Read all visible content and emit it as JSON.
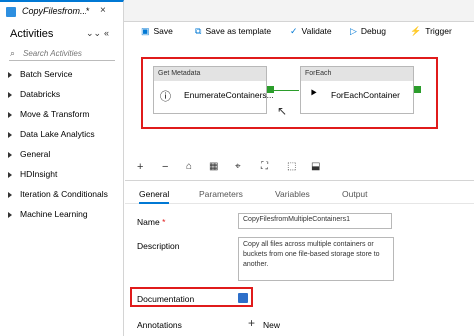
{
  "doc_tab": {
    "title": "CopyFilesfrom...",
    "modified": "*",
    "close": "×"
  },
  "sidebar": {
    "title": "Activities",
    "collapse_icon": "double-chevron-down",
    "minimize_icon": "double-chevron-left",
    "search_placeholder": "Search Activities",
    "categories": [
      "Batch Service",
      "Databricks",
      "Move & Transform",
      "Data Lake Analytics",
      "General",
      "HDInsight",
      "Iteration & Conditionals",
      "Machine Learning"
    ]
  },
  "toolbar": {
    "save": "Save",
    "save_template": "Save as template",
    "validate": "Validate",
    "debug": "Debug",
    "trigger": "Trigger"
  },
  "canvas": {
    "activities": [
      {
        "type": "Get Metadata",
        "name": "EnumerateContainers..."
      },
      {
        "type": "ForEach",
        "name": "ForEachContainer"
      }
    ],
    "highlight_color": "#e01b1b",
    "connector_color": "#2b9d2b"
  },
  "canvas_tools": [
    "plus",
    "minus",
    "lock",
    "grid",
    "zoom-fit",
    "fit-screen",
    "select",
    "layout"
  ],
  "properties": {
    "tabs": [
      "General",
      "Parameters",
      "Variables",
      "Output"
    ],
    "active_tab": "General",
    "name_label": "Name",
    "required_mark": "*",
    "name_value": "CopyFilesfromMultipleContainers1",
    "description_label": "Description",
    "description_value": "Copy all files across multiple containers or buckets from one file-based storage store to another.",
    "documentation_label": "Documentation",
    "annotations_label": "Annotations",
    "new_label": "New"
  }
}
